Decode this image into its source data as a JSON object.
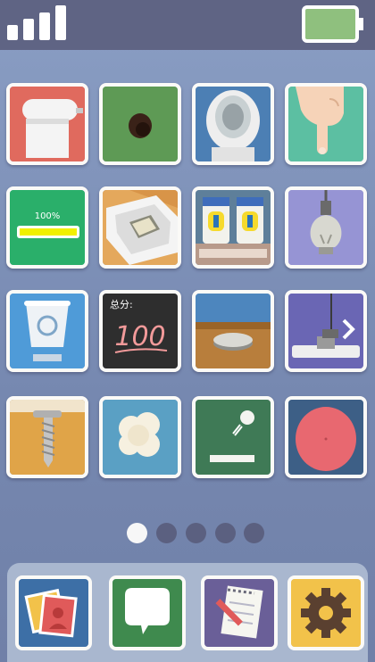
{
  "status_bar": {
    "signal_icon": "signal-bars-icon",
    "battery_icon": "battery-icon",
    "battery_color": "#8fc07e"
  },
  "grid": {
    "rows": [
      [
        "toilet-paper",
        "hole",
        "toilet",
        "pointing-finger"
      ],
      [
        "battery-level",
        "phone-in-tray",
        "jars-on-shelf",
        "light-bulb"
      ],
      [
        "recycle-bin",
        "score-board",
        "stone-disc",
        "power-plug"
      ],
      [
        "screw-in-wood",
        "popcorn",
        "ball-launcher",
        "red-ball"
      ]
    ],
    "battery_tile": {
      "label": "100%",
      "level": 1.0
    },
    "score_tile": {
      "caption": "总分:",
      "score": "100"
    }
  },
  "pagination": {
    "pages": 5,
    "current": 1
  },
  "dock": {
    "items": [
      "photos",
      "messages",
      "notes",
      "settings"
    ]
  },
  "colors": {
    "background": "#7688b0",
    "status_bar": "#5f6484",
    "dock": "#a9b7cf",
    "tile_border": "#fbfaf7"
  }
}
